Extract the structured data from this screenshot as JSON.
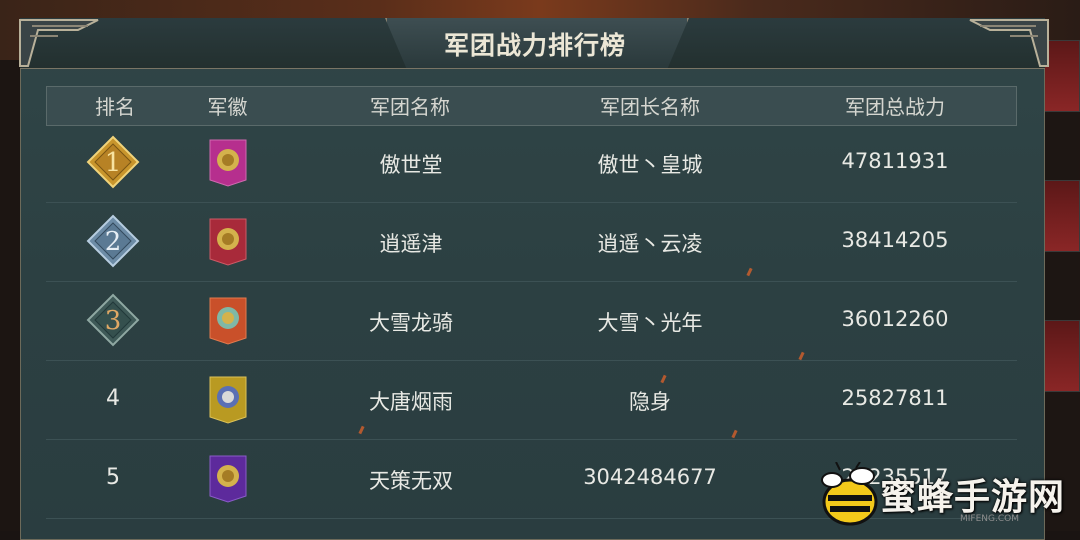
{
  "window": {
    "title": "军团战力排行榜"
  },
  "table": {
    "headers": {
      "rank": "排名",
      "emblem": "军徽",
      "legion_name": "军团名称",
      "leader_name": "军团长名称",
      "power": "军团总战力"
    },
    "rows": [
      {
        "rank": "1",
        "legion_name": "傲世堂",
        "leader_name": "傲世丶皇城",
        "power": "47811931",
        "emblem_icon": "legion-emblem-magenta-icon",
        "emblem_color": "#b62f8e"
      },
      {
        "rank": "2",
        "legion_name": "逍遥津",
        "leader_name": "逍遥丶云凌",
        "power": "38414205",
        "emblem_icon": "legion-emblem-red-icon",
        "emblem_color": "#a82a3a"
      },
      {
        "rank": "3",
        "legion_name": "大雪龙骑",
        "leader_name": "大雪丶光年",
        "power": "36012260",
        "emblem_icon": "legion-emblem-orange-icon",
        "emblem_color": "#c9502a"
      },
      {
        "rank": "4",
        "legion_name": "大唐烟雨",
        "leader_name": "隐身",
        "power": "25827811",
        "emblem_icon": "legion-emblem-gold-icon",
        "emblem_color": "#b99a22"
      },
      {
        "rank": "5",
        "legion_name": "天策无双",
        "leader_name": "3042484677",
        "power": "23235517",
        "emblem_icon": "legion-emblem-purple-icon",
        "emblem_color": "#5d2a9c"
      }
    ]
  },
  "watermark": {
    "text": "蜜蜂手游网",
    "sub": "MIFENG.COM",
    "icon": "bee-logo-icon"
  },
  "colors": {
    "panel": "#2c4042",
    "text": "#e8e9e4",
    "gold_badge": "#d4a83a",
    "silver_badge": "#6f8fa8",
    "bronze_badge": "#4f6c6a"
  }
}
